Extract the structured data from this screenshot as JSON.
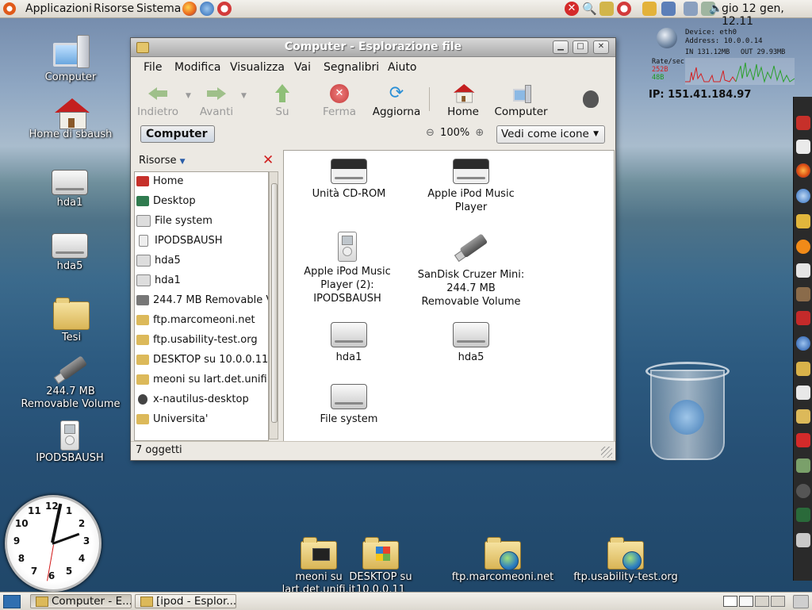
{
  "top_panel": {
    "menus": [
      "Applicazioni",
      "Risorse",
      "Sistema"
    ],
    "clock": "gio 12 gen, 12.11"
  },
  "desktop_icons": [
    {
      "label": "Computer"
    },
    {
      "label": "Home di sbaush"
    },
    {
      "label": "hda1"
    },
    {
      "label": "hda5"
    },
    {
      "label": "Tesi"
    },
    {
      "label": "244.7 MB Removable Volume"
    },
    {
      "label": "IPODSBAUSH"
    }
  ],
  "bottom_desktop_icons": [
    {
      "label": "meoni su lart.det.unifi.it"
    },
    {
      "label": "DESKTOP su 10.0.0.11"
    },
    {
      "label": "ftp.marcomeoni.net"
    },
    {
      "label": "ftp.usability-test.org"
    }
  ],
  "window": {
    "title": "Computer - Esplorazione file",
    "menubar": [
      "File",
      "Modifica",
      "Visualizza",
      "Vai",
      "Segnalibri",
      "Aiuto"
    ],
    "toolbar": {
      "back": "Indietro",
      "forward": "Avanti",
      "up": "Su",
      "stop": "Ferma",
      "reload": "Aggiorna",
      "home": "Home",
      "computer": "Computer"
    },
    "location_button": "Computer",
    "zoom": "100%",
    "view_mode": "Vedi come icone",
    "sidebar": {
      "title": "Risorse",
      "items": [
        "Home",
        "Desktop",
        "File system",
        "IPODSBAUSH",
        "hda5",
        "hda1",
        "244.7 MB Removable V",
        "ftp.marcomeoni.net",
        "ftp.usability-test.org",
        "DESKTOP su 10.0.0.11",
        "meoni su lart.det.unifi",
        "x-nautilus-desktop",
        "Universita'"
      ]
    },
    "files": [
      [
        "Unità CD-ROM"
      ],
      [
        "Apple iPod Music",
        "Player"
      ],
      [
        "Apple iPod Music",
        "Player (2):",
        "IPODSBAUSH"
      ],
      [
        "SanDisk Cruzer Mini:",
        "244.7 MB",
        "Removable Volume"
      ],
      [
        "hda1"
      ],
      [
        "hda5"
      ],
      [
        "File system"
      ]
    ],
    "status": "7 oggetti"
  },
  "net_monitor": {
    "device": "Device: eth0",
    "address": "Address: 10.0.0.14",
    "in": "IN 131.12MB",
    "out": "OUT 29.93MB",
    "rate_label": "Rate/sec",
    "rate_in": "252B",
    "rate_out": "48B"
  },
  "ip_label": "IP: 151.41.184.97",
  "clock_numbers": [
    "12",
    "1",
    "2",
    "3",
    "4",
    "5",
    "6",
    "7",
    "8",
    "9",
    "10",
    "11"
  ],
  "taskbar": [
    "Computer - E...",
    "[ipod - Esplor..."
  ],
  "colors": {
    "panel": "#dcd8cf",
    "accent": "#3a6fb0",
    "close": "#d02020"
  }
}
